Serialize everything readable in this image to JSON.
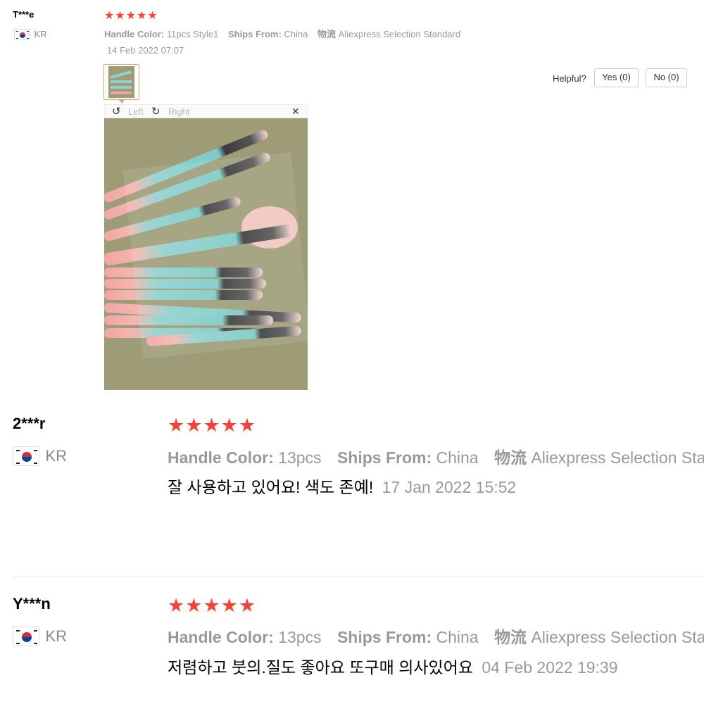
{
  "reviews": [
    {
      "user": "T***e",
      "country": "KR",
      "sku": [
        {
          "key": "Handle Color:",
          "value": "11pcs Style1"
        },
        {
          "key": "Ships From:",
          "value": "China"
        },
        {
          "key": "物流",
          "value": "Aliexpress Selection Standard"
        }
      ],
      "date": "14 Feb 2022 07:07",
      "helpful": {
        "label": "Helpful?",
        "yes": "Yes (0)",
        "no": "No (0)"
      },
      "viewer": {
        "left": "Left",
        "right": "Right"
      }
    },
    {
      "user": "2***r",
      "country": "KR",
      "sku": [
        {
          "key": "Handle Color:",
          "value": "13pcs"
        },
        {
          "key": "Ships From:",
          "value": "China"
        },
        {
          "key": "物流",
          "value": "Aliexpress Selection Stan"
        }
      ],
      "text": "잘 사용하고 있어요! 색도 존예!",
      "date": "17 Jan 2022 15:52"
    },
    {
      "user": "Y***n",
      "country": "KR",
      "sku": [
        {
          "key": "Handle Color:",
          "value": "13pcs"
        },
        {
          "key": "Ships From:",
          "value": "China"
        },
        {
          "key": "物流",
          "value": "Aliexpress Selection Stan"
        }
      ],
      "text": "저렴하고 붓의.질도 좋아요 또구매 의사있어요",
      "date": "04 Feb 2022 19:39"
    }
  ],
  "rating": {
    "stars": 5,
    "max": 5
  },
  "colors": {
    "star": "#f44336",
    "thumb_border": "#f0a060"
  }
}
